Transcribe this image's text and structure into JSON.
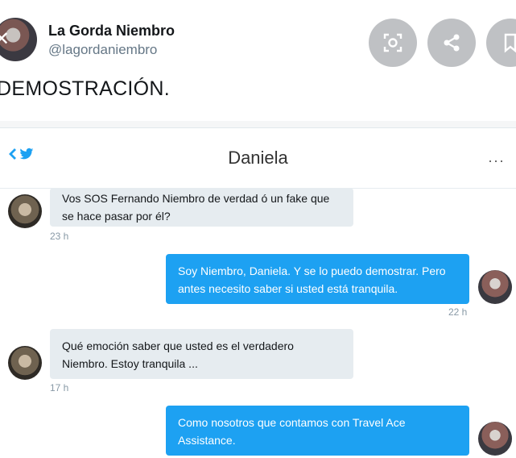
{
  "header": {
    "name": "La Gorda Niembro",
    "handle": "@lagordaniembro",
    "tweet_text": "DEMOSTRACIÓN."
  },
  "conversation": {
    "title": "Daniela",
    "more": "···",
    "messages": [
      {
        "direction": "in",
        "text": "Vos SOS Fernando Niembro de verdad ó un fake que se hace pasar por él?",
        "time": "23 h"
      },
      {
        "direction": "out",
        "text": "Soy Niembro, Daniela. Y se lo puedo demostrar. Pero antes necesito saber si usted está tranquila.",
        "time": "22 h"
      },
      {
        "direction": "in",
        "text": "Qué emoción saber que usted es el verdadero Niembro. Estoy tranquila ...",
        "time": "17 h"
      },
      {
        "direction": "out",
        "text": "Como nosotros que contamos con Travel Ace Assistance.",
        "time": ""
      }
    ]
  },
  "icons": [
    "close-icon",
    "lens-icon",
    "share-icon",
    "bookmark-icon",
    "back-chevron-icon",
    "twitter-bird-icon"
  ],
  "colors": {
    "twitter_blue": "#1da1f2",
    "incoming_bubble": "#e6ecf0",
    "button_gray": "#bfc1c4"
  }
}
